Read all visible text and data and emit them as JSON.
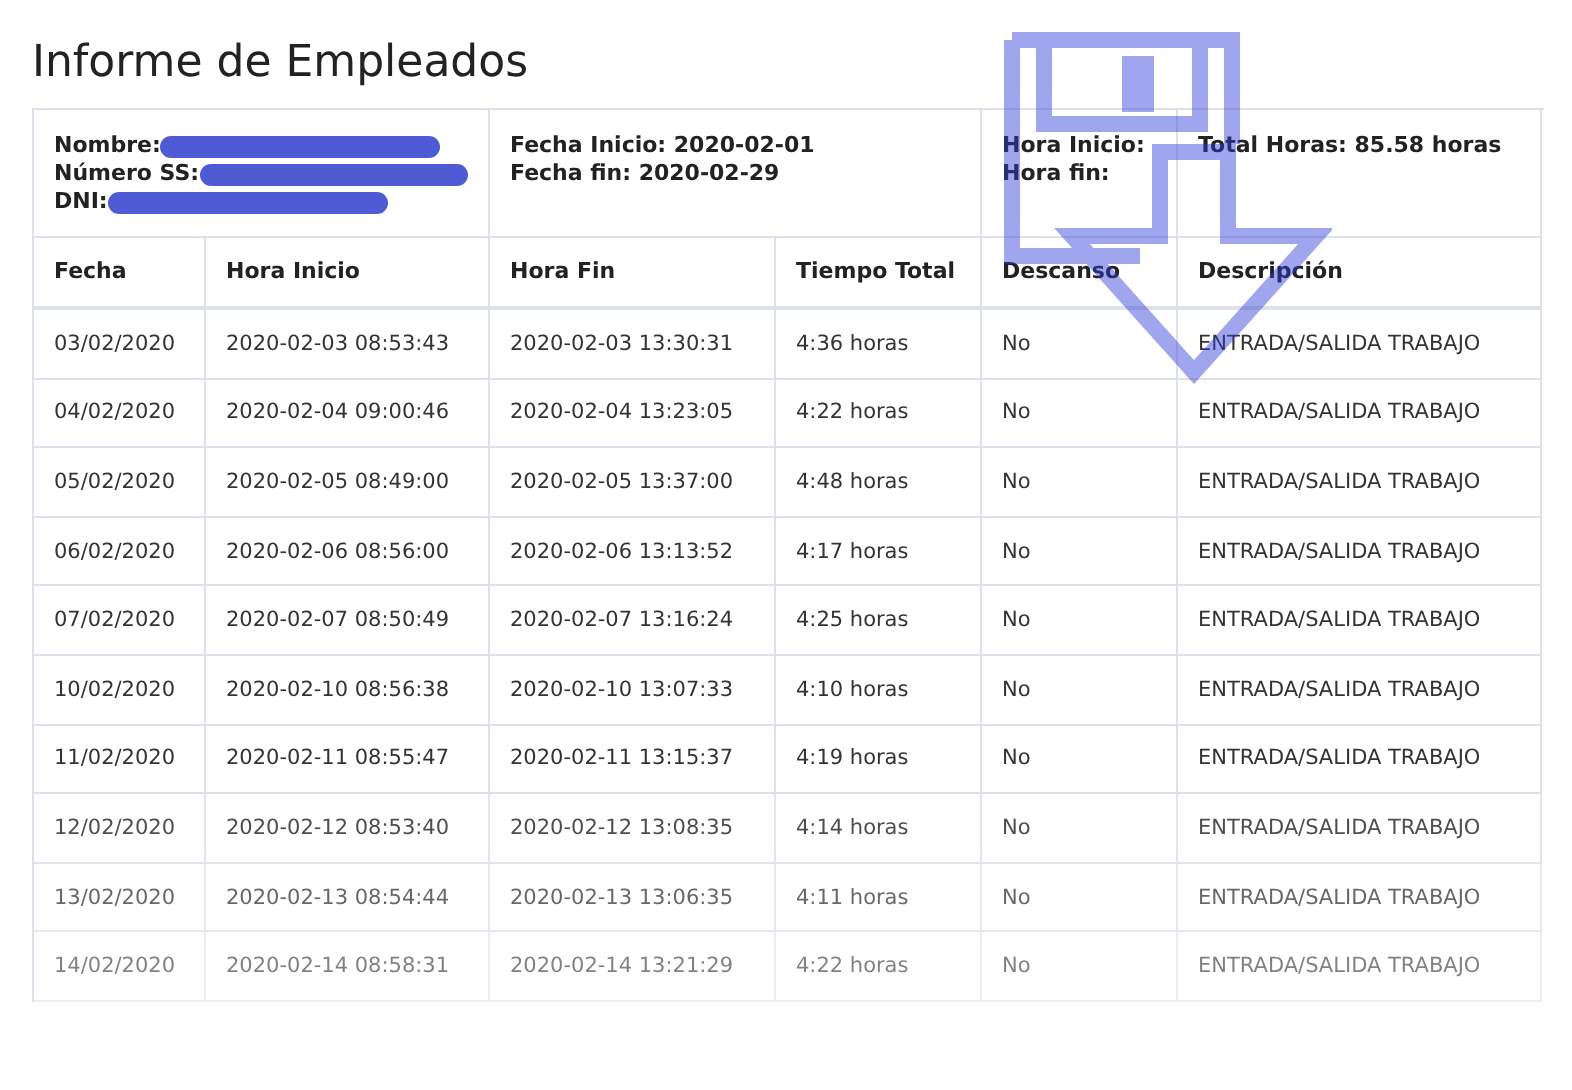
{
  "title": "Informe de Empleados",
  "summary": {
    "employee": [
      {
        "label": "Nombre:",
        "redacted": true
      },
      {
        "label": "Número SS:",
        "redacted": true
      },
      {
        "label": "DNI:",
        "redacted": true
      }
    ],
    "dates": [
      "Fecha Inicio: 2020-02-01",
      "Fecha fin: 2020-02-29"
    ],
    "hours": [
      "Hora Inicio:",
      "Hora fin:"
    ],
    "total": "Total Horas: 85.58 horas"
  },
  "table": {
    "columns": [
      "Fecha",
      "Hora Inicio",
      "Hora Fin",
      "Tiempo Total",
      "Descanso",
      "Descripción"
    ],
    "rows": [
      {
        "fecha": "03/02/2020",
        "inicio": "2020-02-03 08:53:43",
        "fin": "2020-02-03 13:30:31",
        "total": "4:36 horas",
        "descanso": "No",
        "descripcion": "ENTRADA/SALIDA TRABAJO"
      },
      {
        "fecha": "04/02/2020",
        "inicio": "2020-02-04 09:00:46",
        "fin": "2020-02-04 13:23:05",
        "total": "4:22 horas",
        "descanso": "No",
        "descripcion": "ENTRADA/SALIDA TRABAJO"
      },
      {
        "fecha": "05/02/2020",
        "inicio": "2020-02-05 08:49:00",
        "fin": "2020-02-05 13:37:00",
        "total": "4:48 horas",
        "descanso": "No",
        "descripcion": "ENTRADA/SALIDA TRABAJO"
      },
      {
        "fecha": "06/02/2020",
        "inicio": "2020-02-06 08:56:00",
        "fin": "2020-02-06 13:13:52",
        "total": "4:17 horas",
        "descanso": "No",
        "descripcion": "ENTRADA/SALIDA TRABAJO"
      },
      {
        "fecha": "07/02/2020",
        "inicio": "2020-02-07 08:50:49",
        "fin": "2020-02-07 13:16:24",
        "total": "4:25 horas",
        "descanso": "No",
        "descripcion": "ENTRADA/SALIDA TRABAJO"
      },
      {
        "fecha": "10/02/2020",
        "inicio": "2020-02-10 08:56:38",
        "fin": "2020-02-10 13:07:33",
        "total": "4:10 horas",
        "descanso": "No",
        "descripcion": "ENTRADA/SALIDA TRABAJO"
      },
      {
        "fecha": "11/02/2020",
        "inicio": "2020-02-11 08:55:47",
        "fin": "2020-02-11 13:15:37",
        "total": "4:19 horas",
        "descanso": "No",
        "descripcion": "ENTRADA/SALIDA TRABAJO"
      },
      {
        "fecha": "12/02/2020",
        "inicio": "2020-02-12 08:53:40",
        "fin": "2020-02-12 13:08:35",
        "total": "4:14 horas",
        "descanso": "No",
        "descripcion": "ENTRADA/SALIDA TRABAJO"
      },
      {
        "fecha": "13/02/2020",
        "inicio": "2020-02-13 08:54:44",
        "fin": "2020-02-13 13:06:35",
        "total": "4:11 horas",
        "descanso": "No",
        "descripcion": "ENTRADA/SALIDA TRABAJO"
      },
      {
        "fecha": "14/02/2020",
        "inicio": "2020-02-14 08:58:31",
        "fin": "2020-02-14 13:21:29",
        "total": "4:22 horas",
        "descanso": "No",
        "descripcion": "ENTRADA/SALIDA TRABAJO"
      }
    ]
  }
}
